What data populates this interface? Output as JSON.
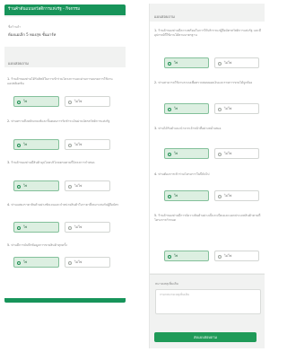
{
  "left_screen": {
    "header_title": "ร้านค้าต้นแบบสวัสดิการแห่งรัฐ - กิจกรรม",
    "store_label": "ชื่อร้านค้า",
    "store_name": "ห้องแม่เล็ก 5 ทองสุข ชั้นมาร์ท",
    "section_title": "แบบสอบถาม",
    "questions": [
      {
        "num": "1.",
        "text": "ร้านค้าของท่านได้รับสิทธิในการเข้าร่วมโครงการและผ่านการอบรมการใช้งานแอปพลิเคชัน"
      },
      {
        "num": "2.",
        "text": "ท่านทราบถึงหลักเกณฑ์และขั้นตอนการรับชำระเงินผ่านบัตรสวัสดิการแห่งรัฐ"
      },
      {
        "num": "3.",
        "text": "ร้านค้าของท่านมีสินค้าอุปโภคบริโภคครบตามที่โครงการกำหนด"
      },
      {
        "num": "4.",
        "text": "ท่านแสดงราคาสินค้าอย่างชัดเจนและจำหน่ายสินค้าในราคาที่เหมาะสมกับผู้ถือบัตร"
      },
      {
        "num": "5.",
        "text": "ท่านมีการบันทึกข้อมูลการขายสินค้าทุกครั้ง"
      }
    ],
    "yes_label": "ใช่",
    "no_label": "ไม่ใช่"
  },
  "right_screen": {
    "section_title": "แบบสอบถาม",
    "questions": [
      {
        "num": "1.",
        "text": "ร้านค้าของท่านมีความพร้อมในการให้บริการแก่ผู้ถือบัตรสวัสดิการแห่งรัฐ และมีอุปกรณ์ที่ใช้งานได้ตามมาตรฐาน"
      },
      {
        "num": "2.",
        "text": "ท่านสามารถใช้งานระบบเพื่อตรวจสอบยอดเงินและรายการขายได้ถูกต้อง"
      },
      {
        "num": "3.",
        "text": "ท่านได้รับคำแนะนำจากเจ้าหน้าที่อย่างสม่ำเสมอ"
      },
      {
        "num": "4.",
        "text": "ท่านต้องการเข้าร่วมโครงการในปีถัดไป"
      },
      {
        "num": "5.",
        "text": "ร้านค้าของท่านมีการจัดวางสินค้าอย่างเป็นระเบียบและแยกประเภทสินค้าตามที่โครงการกำหนด"
      }
    ],
    "yes_label": "ใช่",
    "no_label": "ไม่ใช่",
    "remark_label": "หมายเหตุเพิ่มเติม",
    "remark_placeholder": "กรอกหมายเหตุเพิ่มเติม",
    "submit_label": "ส่งแบบสอบถาม"
  },
  "colors": {
    "brand_green": "#17945a",
    "selected_fill": "#dcefe1",
    "background": "#f1f2f1"
  }
}
